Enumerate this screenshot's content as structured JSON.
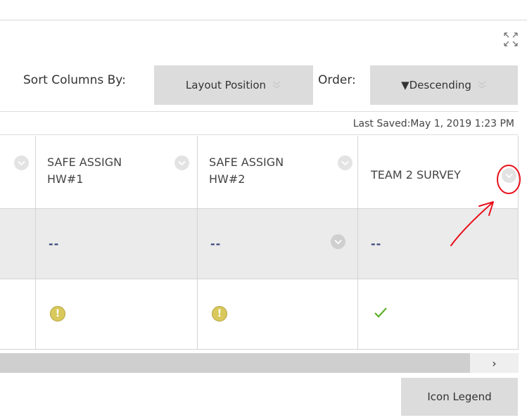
{
  "toolbar": {
    "sort_label": "Sort Columns By:",
    "sort_value": "Layout Position",
    "order_label": "Order:",
    "order_value": "▼Descending"
  },
  "status": {
    "last_saved": "Last Saved:May 1, 2019 1:23 PM"
  },
  "grid": {
    "columns": [
      {
        "title_line1": "SAFE ASSIGN",
        "title_line2": "HW#1"
      },
      {
        "title_line1": "SAFE ASSIGN",
        "title_line2": "HW#2"
      },
      {
        "title_line1": "TEAM 2 SURVEY",
        "title_line2": ""
      }
    ],
    "average_row": [
      "--",
      "--",
      "--"
    ],
    "student_row": [
      {
        "status": "needs-grading-icon",
        "symbol": "!"
      },
      {
        "status": "needs-grading-icon",
        "symbol": "!"
      },
      {
        "status": "completed-check-icon",
        "symbol": ""
      }
    ]
  },
  "scrollbar": {
    "right_arrow": "›"
  },
  "footer": {
    "icon_legend": "Icon Legend"
  },
  "colors": {
    "annotation": "#e8101a",
    "check": "#5db028",
    "warning": "#d9c85c",
    "button_bg": "#dcdcdc"
  }
}
